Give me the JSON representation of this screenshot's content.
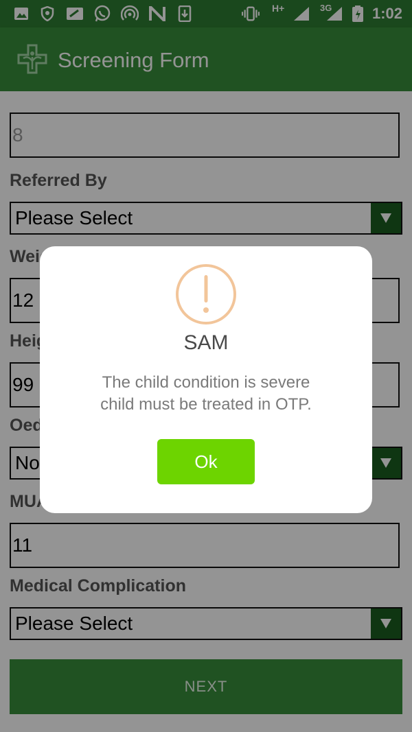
{
  "status_bar": {
    "time": "1:02",
    "network_labels": [
      "H+",
      "3G"
    ],
    "icons": [
      "image-icon",
      "shield-icon",
      "card-icon",
      "whatsapp-icon",
      "hotspot-icon",
      "n-icon",
      "download-icon",
      "vibrate-icon",
      "signal-icon",
      "battery-icon"
    ]
  },
  "app_bar": {
    "title": "Screening Form"
  },
  "form": {
    "first_value": "8",
    "referred_by": {
      "label": "Referred By",
      "value": "Please Select"
    },
    "weight": {
      "label": "Weight",
      "value": "12"
    },
    "height": {
      "label": "Height",
      "value": "99"
    },
    "oedema": {
      "label": "Oedema",
      "value": "No"
    },
    "muac": {
      "label": "MUAC",
      "value": "11"
    },
    "medical_complication": {
      "label": "Medical Complication",
      "value": "Please Select"
    },
    "next_label": "NEXT"
  },
  "dialog": {
    "title": "SAM",
    "message_line1": "The child condition is severe",
    "message_line2": "child must be treated in OTP.",
    "ok_label": "Ok"
  },
  "colors": {
    "status_bar": "#2e7d32",
    "app_bar": "#388e3c",
    "select_arrow": "#1b5e20",
    "alert_icon": "#f2c59a",
    "ok_button": "#6dd400"
  }
}
